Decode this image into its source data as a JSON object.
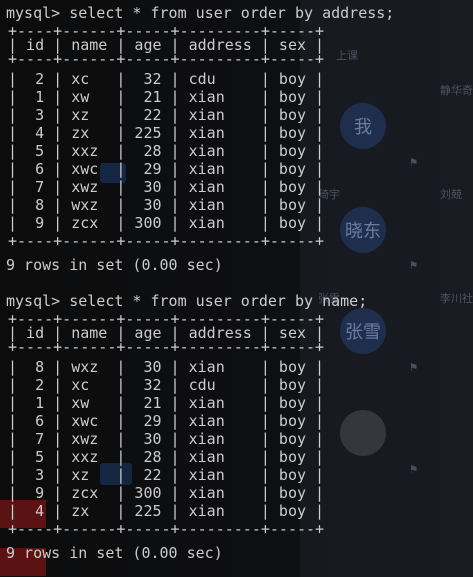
{
  "background": {
    "avatars": [
      "我",
      "晓东",
      "张雪",
      ""
    ],
    "labels": [
      "上课",
      "静华奇",
      "刘兢",
      "李川社",
      "琦宇",
      "张雪"
    ]
  },
  "terminal": {
    "query1": {
      "prompt": "mysql>",
      "command": "select * from user order by address;",
      "columns": [
        "id",
        "name",
        "age",
        "address",
        "sex"
      ],
      "rows": [
        [
          "2",
          "xc",
          "32",
          "cdu",
          "boy"
        ],
        [
          "1",
          "xw",
          "21",
          "xian",
          "boy"
        ],
        [
          "3",
          "xz",
          "22",
          "xian",
          "boy"
        ],
        [
          "4",
          "zx",
          "225",
          "xian",
          "boy"
        ],
        [
          "5",
          "xxz",
          "28",
          "xian",
          "boy"
        ],
        [
          "6",
          "xwc",
          "29",
          "xian",
          "boy"
        ],
        [
          "7",
          "xwz",
          "30",
          "xian",
          "boy"
        ],
        [
          "8",
          "wxz",
          "30",
          "xian",
          "boy"
        ],
        [
          "9",
          "zcx",
          "300",
          "xian",
          "boy"
        ]
      ],
      "result": "9 rows in set (0.00 sec)"
    },
    "query2": {
      "prompt": "mysql>",
      "command": "select * from user order by name;",
      "columns": [
        "id",
        "name",
        "age",
        "address",
        "sex"
      ],
      "rows": [
        [
          "8",
          "wxz",
          "30",
          "xian",
          "boy"
        ],
        [
          "2",
          "xc",
          "32",
          "cdu",
          "boy"
        ],
        [
          "1",
          "xw",
          "21",
          "xian",
          "boy"
        ],
        [
          "6",
          "xwc",
          "29",
          "xian",
          "boy"
        ],
        [
          "7",
          "xwz",
          "30",
          "xian",
          "boy"
        ],
        [
          "5",
          "xxz",
          "28",
          "xian",
          "boy"
        ],
        [
          "3",
          "xz",
          "22",
          "xian",
          "boy"
        ],
        [
          "9",
          "zcx",
          "300",
          "xian",
          "boy"
        ],
        [
          "4",
          "zx",
          "225",
          "xian",
          "boy"
        ]
      ],
      "result": "9 rows in set (0.00 sec)"
    }
  }
}
